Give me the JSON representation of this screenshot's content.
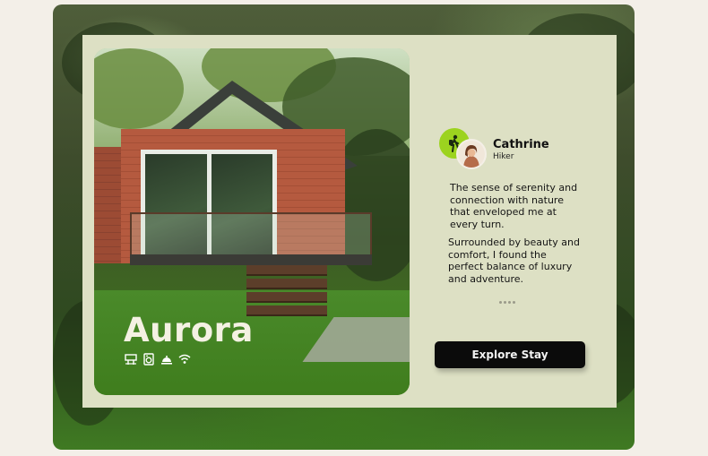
{
  "listing": {
    "name": "Aurora",
    "amenities": [
      {
        "icon": "bathroom-icon"
      },
      {
        "icon": "washing-machine-icon"
      },
      {
        "icon": "room-service-icon"
      },
      {
        "icon": "wifi-icon"
      }
    ]
  },
  "review": {
    "reviewer_name": "Cathrine",
    "reviewer_role": "Hiker",
    "badge_icon": "hiker-icon",
    "paragraph_1": "The sense of serenity and connection with nature that enveloped me at every turn.",
    "paragraph_2": "Surrounded by beauty and comfort, I found the perfect balance of luxury and adventure."
  },
  "cta": {
    "explore_label": "Explore Stay"
  },
  "colors": {
    "card": "#dde0c4",
    "badge": "#9cd31f",
    "button": "#0b0b0b",
    "page": "#f3efe8"
  }
}
